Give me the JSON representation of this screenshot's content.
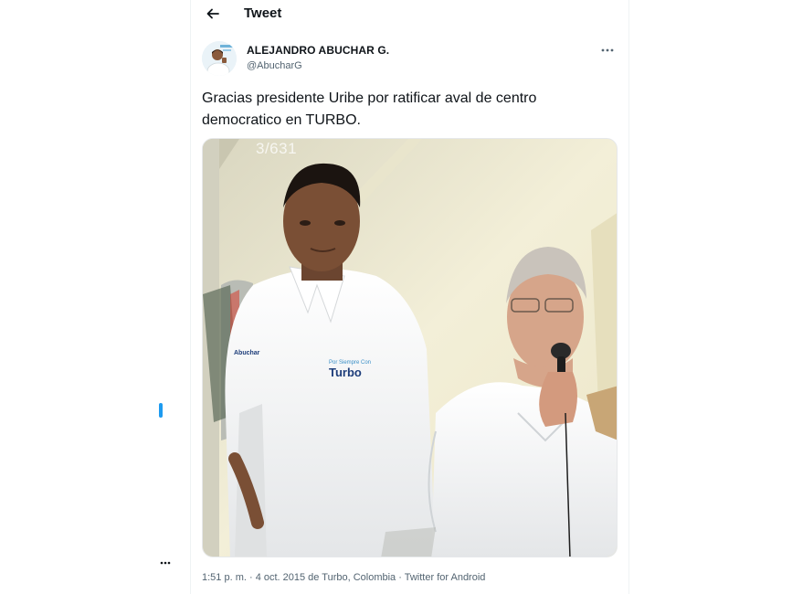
{
  "header": {
    "back_icon": "arrow-left-icon",
    "title": "Tweet"
  },
  "tweet": {
    "author_name": "ALEJANDRO ABUCHAR G.",
    "author_handle": "@AbucharG",
    "more_icon": "more-horizontal-icon",
    "text": "Gracias presidente Uribe por ratificar aval de centro democratico en TURBO.",
    "media": {
      "overlay_counter": "3/631",
      "shirt_logo_left": "Abuchar",
      "shirt_logo_right": "Turbo",
      "shirt_logo_right_small": "Por Siempre Con"
    },
    "meta": "1:51 p. m. · 4 oct. 2015 de Turbo, Colombia · Twitter for Android"
  },
  "colors": {
    "text_primary": "#0f1419",
    "text_secondary": "#536471",
    "accent": "#1d9bf0",
    "border": "#eff3f4"
  },
  "side": {
    "dots_icon": "more-horizontal-icon"
  }
}
